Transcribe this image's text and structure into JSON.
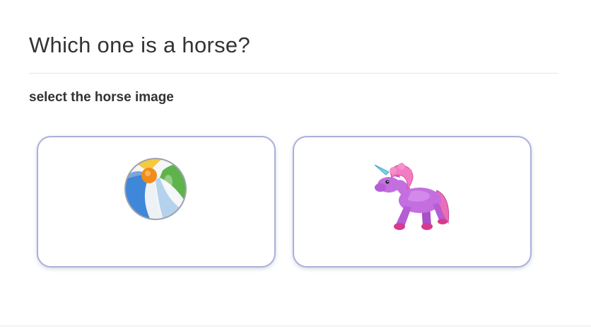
{
  "question": {
    "title": "Which one is a horse?",
    "instruction": "select the horse image"
  },
  "options": [
    {
      "icon": "beach-ball-icon"
    },
    {
      "icon": "unicorn-horse-icon"
    }
  ],
  "colors": {
    "text": "#333333",
    "card_border": "#a9b1d8",
    "divider": "#e6e6e6"
  }
}
